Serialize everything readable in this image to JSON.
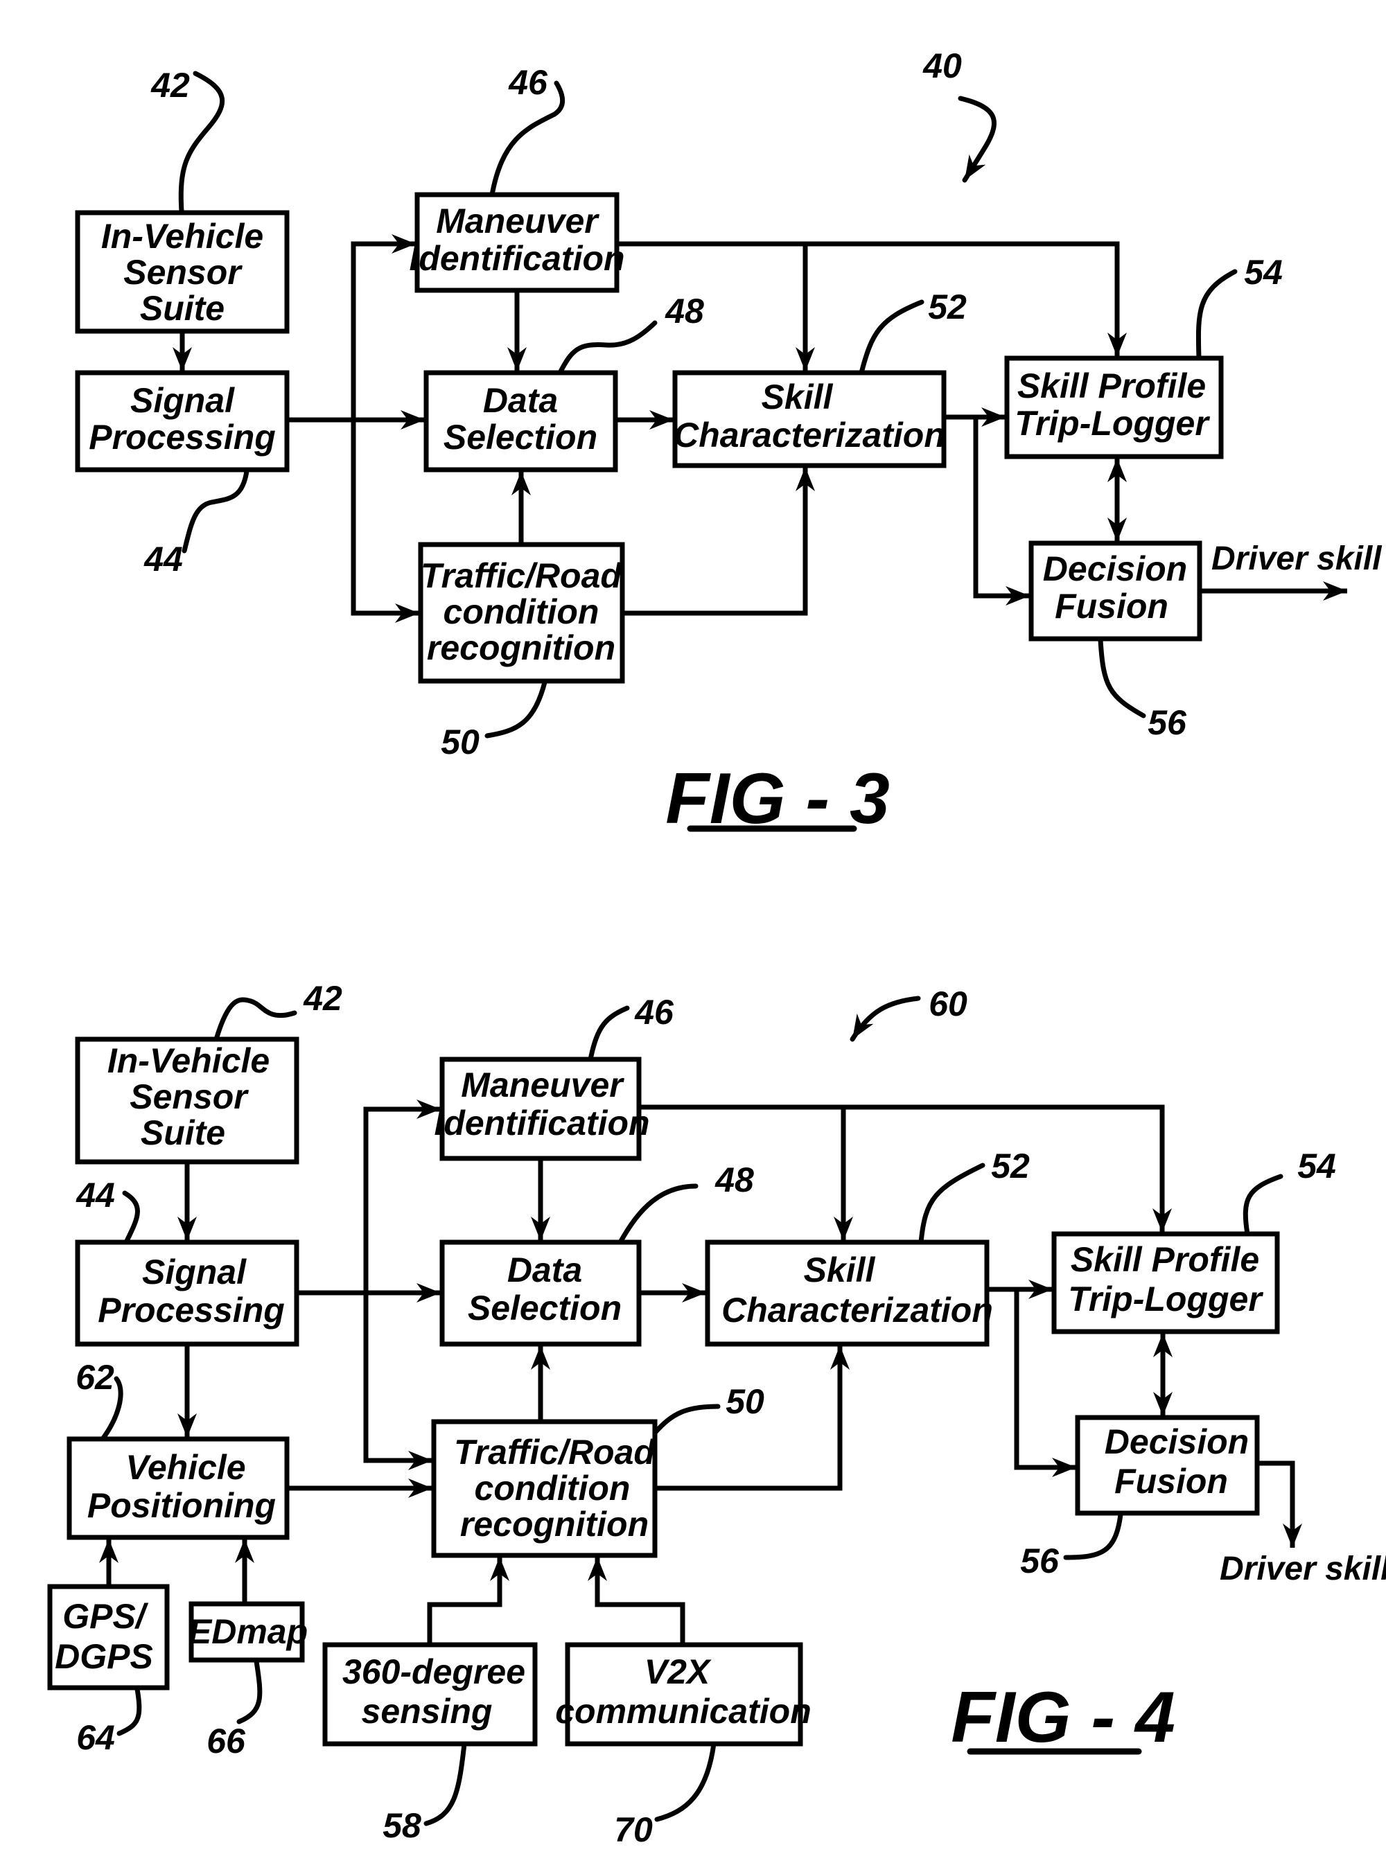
{
  "fig3": {
    "caption": "FIG - 3",
    "ref_system": "40",
    "blocks": {
      "sensor_suite": {
        "lines": [
          "In-Vehicle",
          "Sensor",
          "Suite"
        ],
        "ref": "42"
      },
      "signal_processing": {
        "lines": [
          "Signal",
          "Processing"
        ],
        "ref": "44"
      },
      "maneuver_id": {
        "lines": [
          "Maneuver",
          "Identification"
        ],
        "ref": "46"
      },
      "data_selection": {
        "lines": [
          "Data",
          "Selection"
        ],
        "ref": "48"
      },
      "traffic_road": {
        "lines": [
          "Traffic/Road",
          "condition",
          "recognition"
        ],
        "ref": "50"
      },
      "skill_char": {
        "lines": [
          "Skill",
          "Characterization"
        ],
        "ref": "52"
      },
      "skill_profile": {
        "lines": [
          "Skill Profile",
          "Trip-Logger"
        ],
        "ref": "54"
      },
      "decision_fusion": {
        "lines": [
          "Decision",
          "Fusion"
        ],
        "ref": "56"
      }
    },
    "output_label": "Driver skill"
  },
  "fig4": {
    "caption": "FIG - 4",
    "ref_system": "60",
    "blocks": {
      "sensor_suite": {
        "lines": [
          "In-Vehicle",
          "Sensor",
          "Suite"
        ],
        "ref": "42"
      },
      "signal_processing": {
        "lines": [
          "Signal",
          "Processing"
        ],
        "ref": "44"
      },
      "vehicle_positioning": {
        "lines": [
          "Vehicle",
          "Positioning"
        ],
        "ref": "62"
      },
      "gps": {
        "lines": [
          "GPS/",
          "DGPS"
        ],
        "ref": "64"
      },
      "edmap": {
        "lines": [
          "EDmap"
        ],
        "ref": "66"
      },
      "maneuver_id": {
        "lines": [
          "Maneuver",
          "Identification"
        ],
        "ref": "46"
      },
      "data_selection": {
        "lines": [
          "Data",
          "Selection"
        ],
        "ref": "48"
      },
      "traffic_road": {
        "lines": [
          "Traffic/Road",
          "condition",
          "recognition"
        ],
        "ref": "50"
      },
      "sensing_360": {
        "lines": [
          "360-degree",
          "sensing"
        ],
        "ref": "58"
      },
      "v2x": {
        "lines": [
          "V2X",
          "communication"
        ],
        "ref": "70"
      },
      "skill_char": {
        "lines": [
          "Skill",
          "Characterization"
        ],
        "ref": "52"
      },
      "skill_profile": {
        "lines": [
          "Skill Profile",
          "Trip-Logger"
        ],
        "ref": "54"
      },
      "decision_fusion": {
        "lines": [
          "Decision",
          "Fusion"
        ],
        "ref": "56"
      }
    },
    "output_label": "Driver skill"
  }
}
